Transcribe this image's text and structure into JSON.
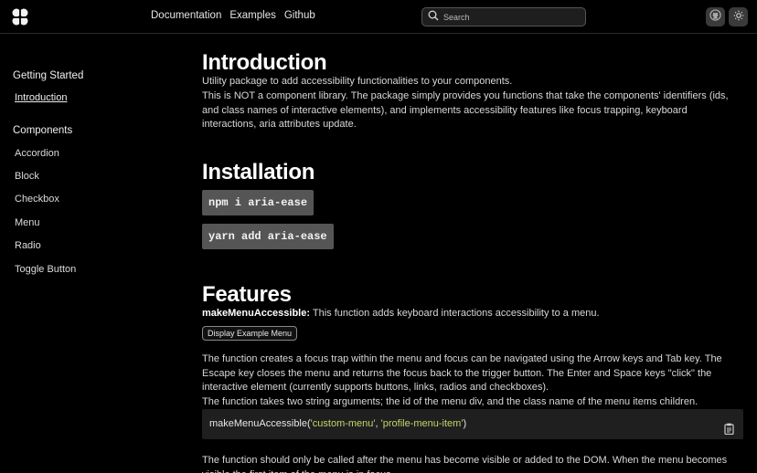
{
  "topbar": {
    "nav": [
      "Documentation",
      "Examples",
      "Github"
    ],
    "search_placeholder": "Search",
    "icons": [
      "logo-icon",
      "search-icon",
      "github-icon",
      "sun-icon"
    ]
  },
  "sidebar": {
    "groups": [
      {
        "title": "Getting Started",
        "items": [
          "Introduction"
        ]
      },
      {
        "title": "Components",
        "items": [
          "Accordion",
          "Block",
          "Checkbox",
          "Menu",
          "Radio",
          "Toggle Button"
        ]
      }
    ]
  },
  "intro": {
    "title": "Introduction",
    "line1": "Utility package to add accessibility functionalities to your components.",
    "line2": "This is NOT a component library. The package simply provides you functions that take the components' identifiers (ids, and class names of interactive elements), and implements accessibility features like focus trapping, keyboard interactions, aria attributes update."
  },
  "install": {
    "title": "Installation",
    "npm": "npm i aria-ease",
    "yarn": "yarn add aria-ease"
  },
  "features": {
    "title": "Features",
    "fn_name": "makeMenuAccessible:",
    "fn_desc": "This function adds keyboard interactions accessibility to a menu.",
    "demo_button": "Display Example Menu",
    "para1": "The function creates a focus trap within the menu and focus can be navigated using the Arrow keys and Tab key. The Escape key closes the menu and returns the focus back to the trigger button. The Enter and Space keys \"click\" the interactive element (currently supports buttons, links, radios and checkboxes).",
    "para2": "The function takes two string arguments; the id of the menu div, and the class name of the menu items children.",
    "code": {
      "fn": "makeMenuAccessible",
      "open": "(",
      "arg1": "'custom-menu'",
      "sep": ", ",
      "arg2": "'profile-menu-item'",
      "close": ")"
    },
    "para3": "The function should only be called after the menu has become visible or added to the DOM. When the menu becomes visible the first item of the menu is in focus."
  },
  "colors": {
    "background": "#000000",
    "code_string": "#c7d36a",
    "command_bg": "#555555",
    "code_bg": "#1f1f1f"
  }
}
